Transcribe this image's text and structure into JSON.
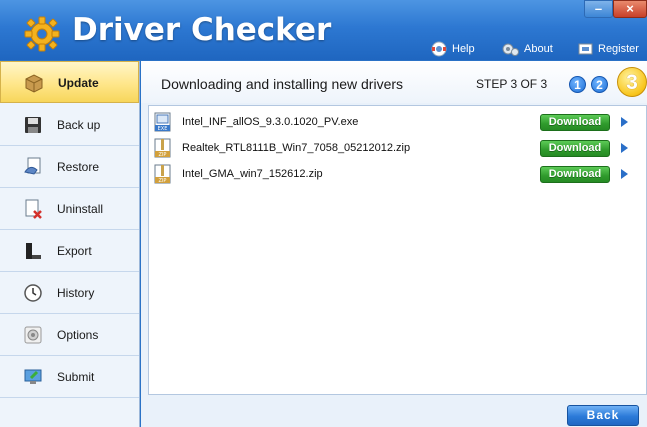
{
  "app": {
    "title": "Driver Checker"
  },
  "window_controls": {
    "minimize": "–",
    "close": "×"
  },
  "top_links": {
    "help": "Help",
    "about": "About",
    "register": "Register"
  },
  "sidebar": {
    "items": [
      {
        "label": "Update",
        "icon": "box-icon",
        "active": true
      },
      {
        "label": "Back up",
        "icon": "floppy-disk-icon",
        "active": false
      },
      {
        "label": "Restore",
        "icon": "restore-icon",
        "active": false
      },
      {
        "label": "Uninstall",
        "icon": "uninstall-icon",
        "active": false
      },
      {
        "label": "Export",
        "icon": "export-icon",
        "active": false
      },
      {
        "label": "History",
        "icon": "history-icon",
        "active": false
      },
      {
        "label": "Options",
        "icon": "options-icon",
        "active": false
      },
      {
        "label": "Submit",
        "icon": "submit-icon",
        "active": false
      }
    ]
  },
  "main": {
    "header": "Downloading and installing new drivers",
    "step_label": "STEP 3 OF 3",
    "steps": [
      "1",
      "2",
      "3"
    ],
    "current_step": 3,
    "files": [
      {
        "name": "Intel_INF_allOS_9.3.0.1020_PV.exe",
        "type": "EXE",
        "action": "Download"
      },
      {
        "name": "Realtek_RTL8111B_Win7_7058_05212012.zip",
        "type": "ZIP",
        "action": "Download"
      },
      {
        "name": "Intel_GMA_win7_152612.zip",
        "type": "ZIP",
        "action": "Download"
      }
    ],
    "back_label": "Back"
  },
  "colors": {
    "titlebar": "#2d78d2",
    "active_nav": "#ffe68a",
    "download_button": "#2f9a2c",
    "back_button": "#2b7ad8"
  }
}
